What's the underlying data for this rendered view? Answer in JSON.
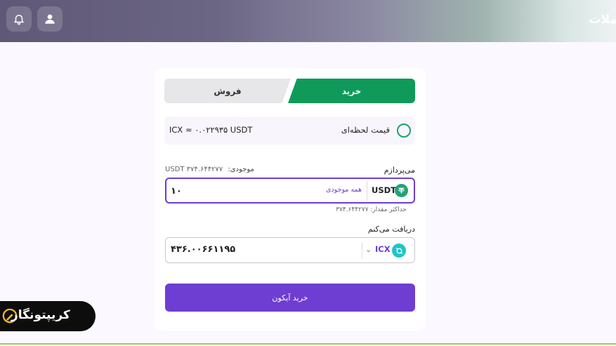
{
  "header": {
    "title": "ملات",
    "notifications_icon": "bell-icon",
    "profile_icon": "user-icon"
  },
  "tabs": {
    "buy": "خرید",
    "sell": "فروش",
    "active": "buy"
  },
  "price": {
    "label": "قیمت لحظه‌ای",
    "value": "ICX ≈ ۰.۰۲۲۹۳۵ USDT"
  },
  "pay": {
    "label": "می‌پردازم",
    "balance_label": "موجودی:",
    "balance_value": "USDT ۳۷۴.۶۴۴۲۷۷",
    "input_value": "۱۰",
    "all_balance": "همه موجودی",
    "currency": "USDT",
    "max_amount": "حداکثر مقدار: ۳۷۴.۶۴۴۲۷۷"
  },
  "receive": {
    "label": "دریافت می‌کنم",
    "value": "۴۳۶.۰۰۶۶۱۱۹۵",
    "currency": "ICX"
  },
  "submit": {
    "label": "خرید آیکون"
  },
  "brand": {
    "name": "کریپتونگار"
  },
  "colors": {
    "buy_green": "#0f9a5a",
    "primary_purple": "#6e3dd2",
    "usdt_green": "#26a17b",
    "icx_teal": "#1fc5c9"
  }
}
